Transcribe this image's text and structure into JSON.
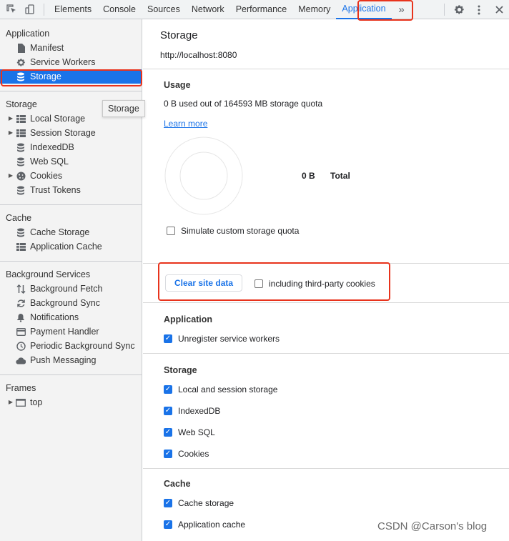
{
  "toolbar": {
    "tabs": [
      "Elements",
      "Console",
      "Sources",
      "Network",
      "Performance",
      "Memory",
      "Application"
    ],
    "more_label": "»",
    "accent": "#1a73e8"
  },
  "sidebar": {
    "application": {
      "heading": "Application",
      "items": [
        "Manifest",
        "Service Workers",
        "Storage"
      ]
    },
    "storage": {
      "heading": "Storage",
      "items": [
        "Local Storage",
        "Session Storage",
        "IndexedDB",
        "Web SQL",
        "Cookies",
        "Trust Tokens"
      ]
    },
    "cache": {
      "heading": "Cache",
      "items": [
        "Cache Storage",
        "Application Cache"
      ]
    },
    "background": {
      "heading": "Background Services",
      "items": [
        "Background Fetch",
        "Background Sync",
        "Notifications",
        "Payment Handler",
        "Periodic Background Sync",
        "Push Messaging"
      ]
    },
    "frames": {
      "heading": "Frames",
      "items": [
        "top"
      ]
    },
    "tooltip": "Storage"
  },
  "main": {
    "title": "Storage",
    "origin": "http://localhost:8080",
    "usage": {
      "title": "Usage",
      "text": "0 B used out of 164593 MB storage quota",
      "learn_more": "Learn more",
      "total_value": "0 B",
      "total_label": "Total",
      "simulate_label": "Simulate custom storage quota"
    },
    "clear": {
      "button": "Clear site data",
      "third_party_label": "including third-party cookies"
    },
    "application": {
      "title": "Application",
      "items": [
        "Unregister service workers"
      ]
    },
    "storage": {
      "title": "Storage",
      "items": [
        "Local and session storage",
        "IndexedDB",
        "Web SQL",
        "Cookies"
      ]
    },
    "cache": {
      "title": "Cache",
      "items": [
        "Cache storage",
        "Application cache"
      ]
    }
  },
  "watermark": "CSDN @Carson's  blog",
  "highlight_color": "#e8331c"
}
